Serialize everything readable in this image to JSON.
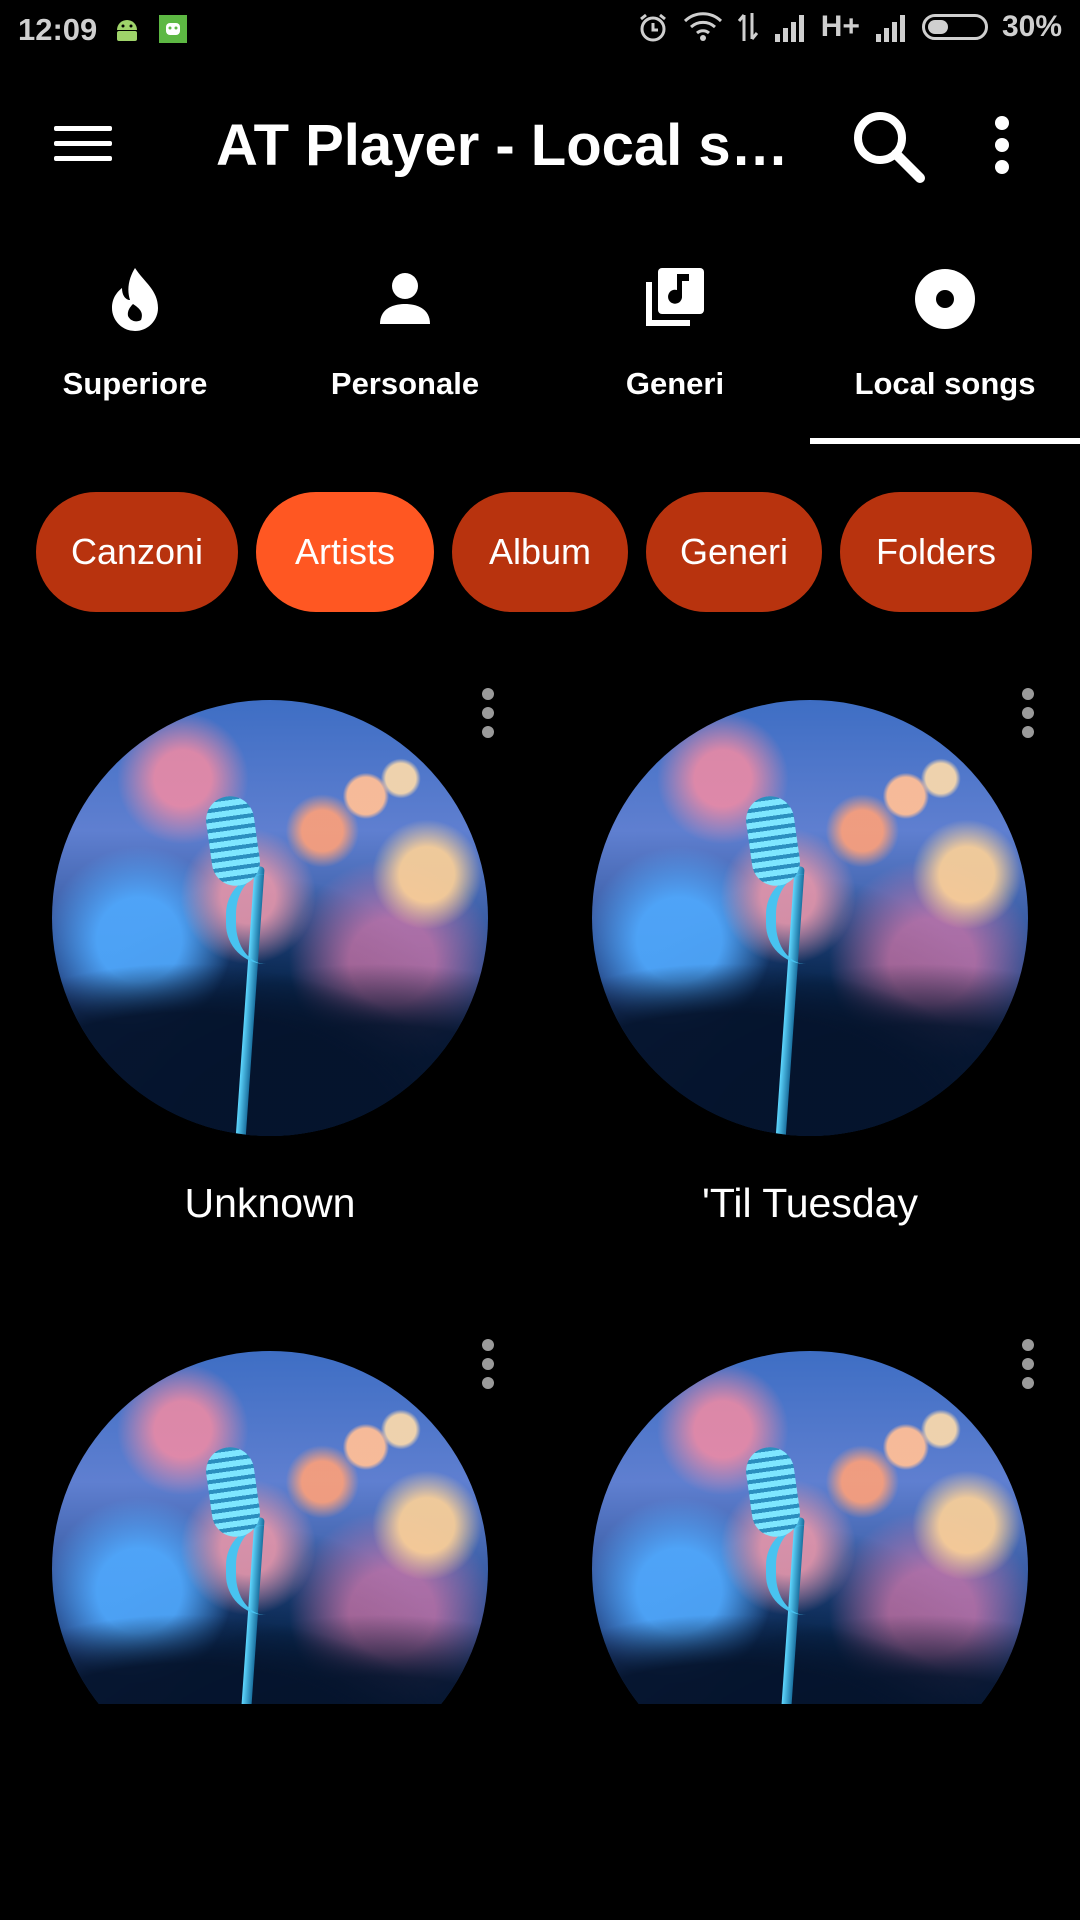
{
  "status_bar": {
    "time": "12:09",
    "network": "H+",
    "battery": "30%",
    "battery_level": 0.3
  },
  "app_bar": {
    "title": "AT Player - Local songs",
    "menu_icon": "hamburger-menu-icon",
    "search_icon": "search-icon",
    "more_icon": "more-vert-icon"
  },
  "tabs": [
    {
      "label": "Superiore",
      "icon": "flame-icon"
    },
    {
      "label": "Personale",
      "icon": "person-icon"
    },
    {
      "label": "Generi",
      "icon": "library-music-icon"
    },
    {
      "label": "Local songs",
      "icon": "album-icon",
      "selected": true
    }
  ],
  "chips": [
    {
      "label": "Canzoni"
    },
    {
      "label": "Artists",
      "selected": true
    },
    {
      "label": "Album"
    },
    {
      "label": "Generi"
    },
    {
      "label": "Folders"
    }
  ],
  "artists": [
    {
      "name": "Unknown"
    },
    {
      "name": "'Til Tuesday"
    },
    {
      "name": ""
    },
    {
      "name": ""
    }
  ],
  "colors": {
    "background": "#000000",
    "chip": "#b8330e",
    "chip_active": "#ff5722",
    "text": "#ffffff"
  }
}
